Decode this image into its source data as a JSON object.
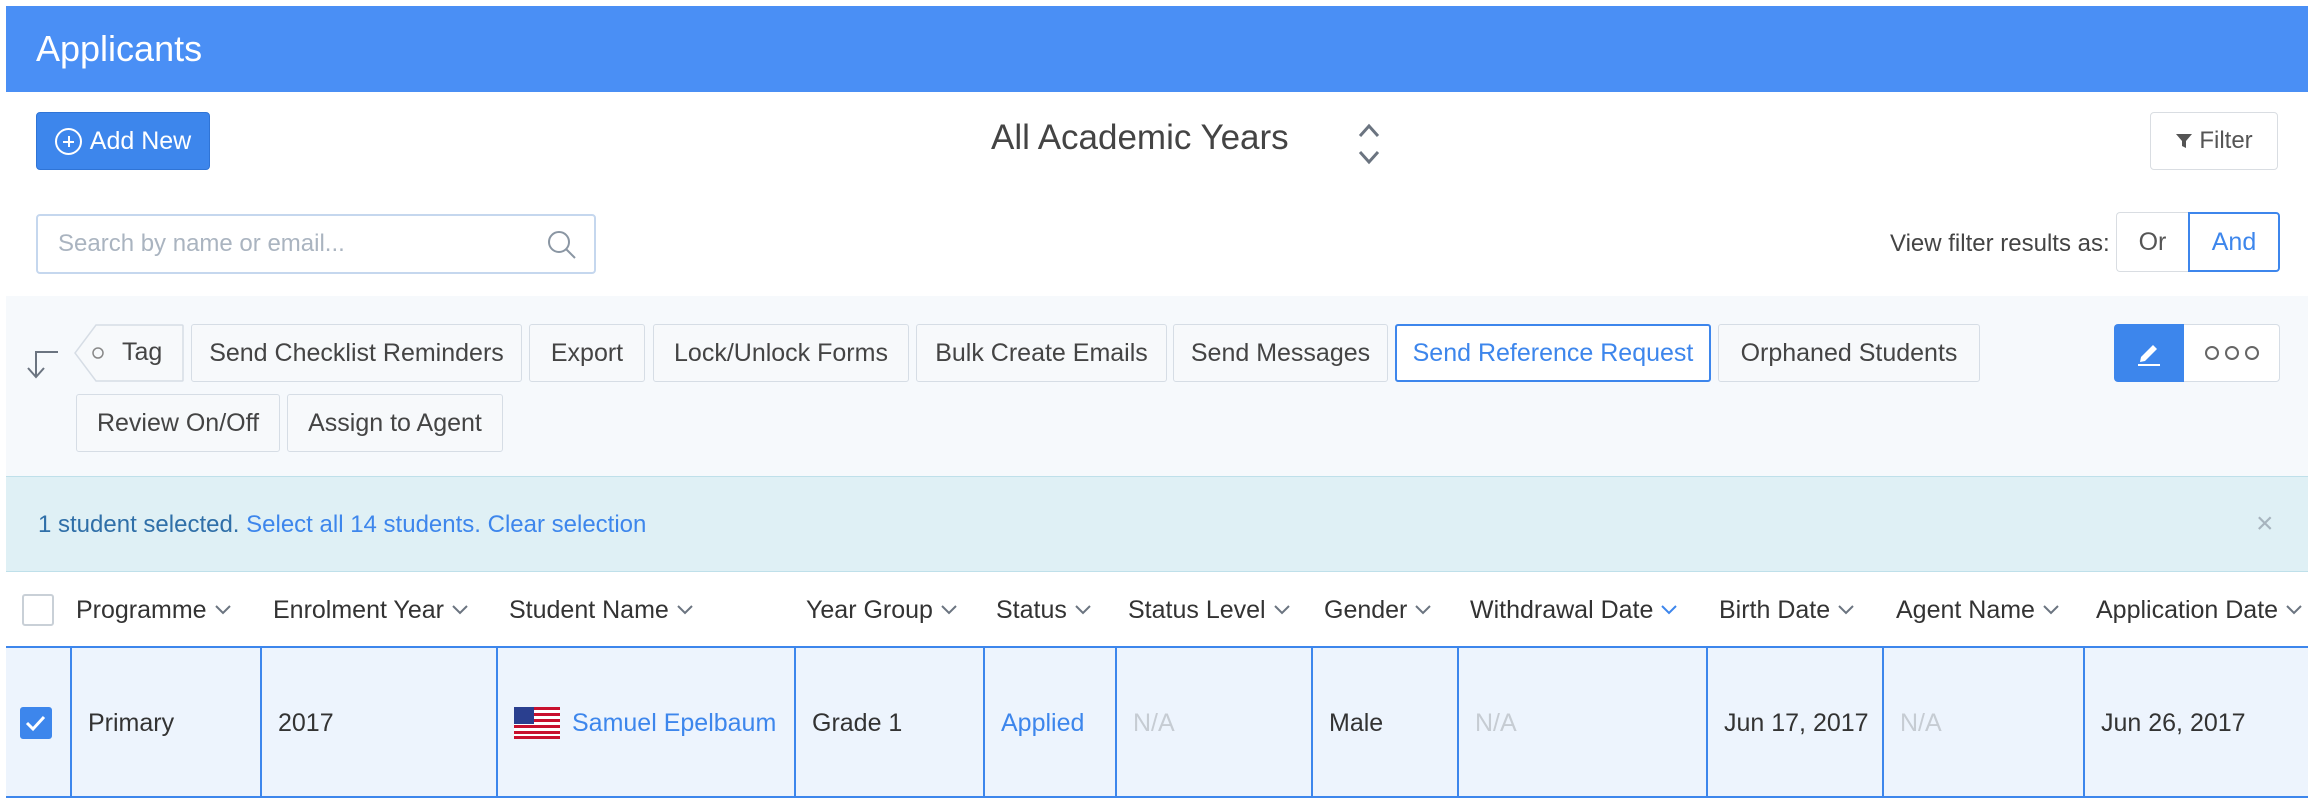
{
  "header": {
    "title": "Applicants"
  },
  "toolbar_top": {
    "add_new_label": "Add New",
    "academic_year": "All Academic Years",
    "filter_label": "Filter"
  },
  "search": {
    "placeholder": "Search by name or email..."
  },
  "view_filter": {
    "label": "View filter results as:",
    "or_label": "Or",
    "and_label": "And",
    "selected": "And"
  },
  "actions": {
    "tag": "Tag",
    "send_checklist_reminders": "Send Checklist Reminders",
    "export": "Export",
    "lock_unlock_forms": "Lock/Unlock Forms",
    "bulk_create_emails": "Bulk Create Emails",
    "send_messages": "Send Messages",
    "send_reference_request": "Send Reference Request",
    "orphaned_students": "Orphaned Students",
    "review_on_off": "Review On/Off",
    "assign_to_agent": "Assign to Agent"
  },
  "selection": {
    "status_text": "1 student selected.",
    "select_all": "Select all 14 students.",
    "clear": "Clear selection",
    "close": "×"
  },
  "table": {
    "columns": [
      "Programme",
      "Enrolment Year",
      "Student Name",
      "Year Group",
      "Status",
      "Status Level",
      "Gender",
      "Withdrawal Date",
      "Birth Date",
      "Agent Name",
      "Application Date"
    ],
    "rows": [
      {
        "selected": true,
        "programme": "Primary",
        "enrolment_year": "2017",
        "student_name": "Samuel Epelbaum",
        "year_group": "Grade 1",
        "status": "Applied",
        "status_level": "N/A",
        "gender": "Male",
        "withdrawal_date": "N/A",
        "birth_date": "Jun 17, 2017",
        "agent_name": "N/A",
        "application_date": "Jun 26, 2017"
      }
    ]
  },
  "colors": {
    "header": "#4a8ff5",
    "accent": "#3d86ec",
    "selection_bar": "#dff0f5",
    "selected_row": "#edf4fd"
  }
}
